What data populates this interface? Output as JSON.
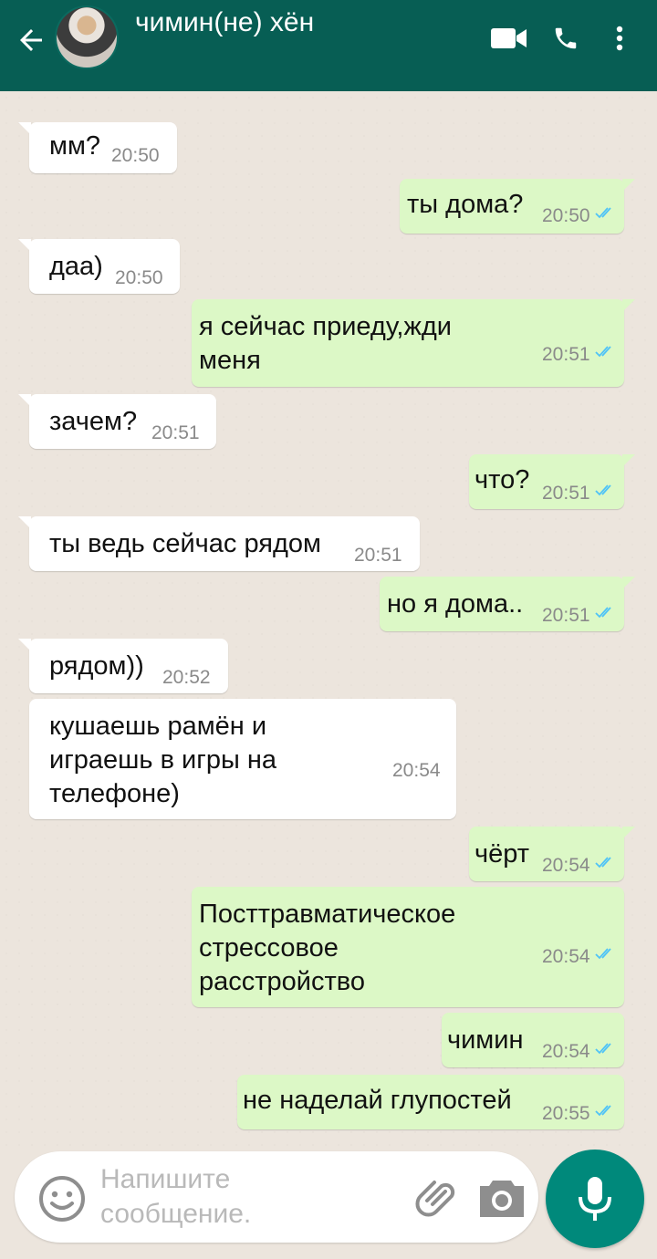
{
  "header": {
    "contact_name": "чимин(не) хён",
    "back_icon": "arrow-left-icon",
    "video_icon": "video-call-icon",
    "phone_icon": "phone-icon",
    "menu_icon": "more-vert-icon",
    "color": "#075e54"
  },
  "messages": [
    {
      "dir": "in",
      "text": "мм?",
      "time": "20:50"
    },
    {
      "dir": "out",
      "text": "ты дома?",
      "time": "20:50"
    },
    {
      "dir": "in",
      "text": "даа)",
      "time": "20:50"
    },
    {
      "dir": "out",
      "text": "я сейчас приеду,жди\nменя",
      "time": "20:51"
    },
    {
      "dir": "in",
      "text": "зачем?",
      "time": "20:51"
    },
    {
      "dir": "out",
      "text": "что?",
      "time": "20:51"
    },
    {
      "dir": "in",
      "text": "ты ведь сейчас рядом",
      "time": "20:51"
    },
    {
      "dir": "out",
      "text": "но я дома..",
      "time": "20:51"
    },
    {
      "dir": "in",
      "text": "рядом))",
      "time": "20:52"
    },
    {
      "dir": "in",
      "text": "кушаешь рамён и\nиграешь в игры на\nтелефоне)",
      "time": "20:54"
    },
    {
      "dir": "out",
      "text": "чёрт",
      "time": "20:54"
    },
    {
      "dir": "out",
      "text": "Посттравматическое\nстрессовое\nрасстройство",
      "time": "20:54"
    },
    {
      "dir": "out",
      "text": "чимин",
      "time": "20:54"
    },
    {
      "dir": "out",
      "text": "не наделай глупостей",
      "time": "20:55"
    }
  ],
  "input": {
    "placeholder": "Напишите\nсообщение.",
    "emoji_icon": "emoji-icon",
    "attach_icon": "paperclip-icon",
    "camera_icon": "camera-icon",
    "mic_icon": "microphone-icon"
  },
  "colors": {
    "outgoing_bubble": "#dcf8c6",
    "incoming_bubble": "#ffffff",
    "read_ticks": "#4fc3f7",
    "mic_button": "#00897b"
  }
}
